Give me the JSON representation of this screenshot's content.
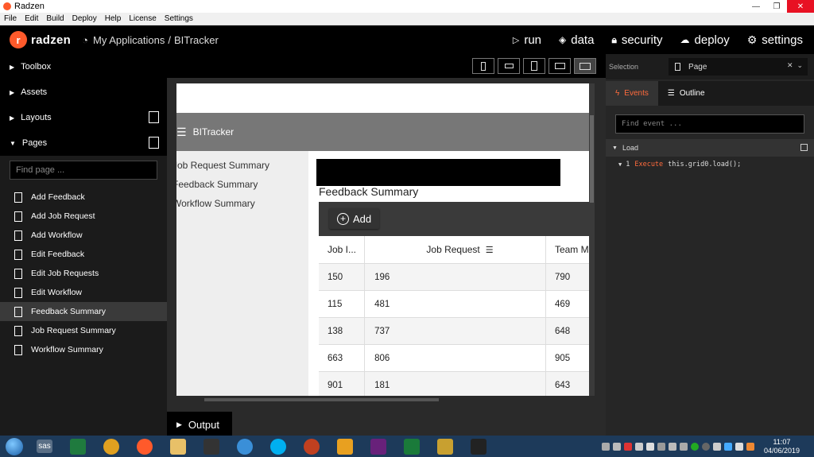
{
  "window": {
    "title": "Radzen"
  },
  "menubar": {
    "items": [
      "File",
      "Edit",
      "Build",
      "Deploy",
      "Help",
      "License",
      "Settings"
    ]
  },
  "topnav": {
    "brand": "radzen",
    "breadcrumb_root": "My Applications",
    "breadcrumb_sep": "/",
    "breadcrumb_app": "BITracker",
    "run": "run",
    "data": "data",
    "security": "security",
    "deploy": "deploy",
    "settings": "settings"
  },
  "left": {
    "toolbox": "Toolbox",
    "assets": "Assets",
    "layouts": "Layouts",
    "pages": "Pages",
    "find_placeholder": "Find page ...",
    "page_items": [
      "Add Feedback",
      "Add Job Request",
      "Add Workflow",
      "Edit Feedback",
      "Edit Job Requests",
      "Edit Workflow",
      "Feedback Summary",
      "Job Request Summary",
      "Workflow Summary"
    ],
    "selected_index": 6
  },
  "canvas": {
    "header_title": "BITracker",
    "nav": [
      "Job Request Summary",
      "Feedback Summary",
      "Workflow Summary"
    ],
    "page_title": "Feedback Summary",
    "add_label": "Add",
    "columns": [
      "Job I...",
      "Job Request",
      "Team M"
    ],
    "rows": [
      [
        "150",
        "196",
        "790"
      ],
      [
        "115",
        "481",
        "469"
      ],
      [
        "138",
        "737",
        "648"
      ],
      [
        "663",
        "806",
        "905"
      ],
      [
        "901",
        "181",
        "643"
      ]
    ]
  },
  "output": {
    "label": "Output"
  },
  "right": {
    "selection_label": "Selection",
    "selection_value": "Page",
    "tab_events": "Events",
    "tab_outline": "Outline",
    "find_event_placeholder": "Find event ...",
    "event_name": "Load",
    "action_index": "1",
    "action_type": "Execute",
    "action_code": "this.grid0.load();"
  },
  "taskbar": {
    "sas": "sas",
    "time": "11:07",
    "date": "04/06/2019"
  },
  "colors": {
    "accent": "#ff5a2b",
    "selected_row": "#3a3a3a",
    "taskbar": "#1d3a5a"
  }
}
